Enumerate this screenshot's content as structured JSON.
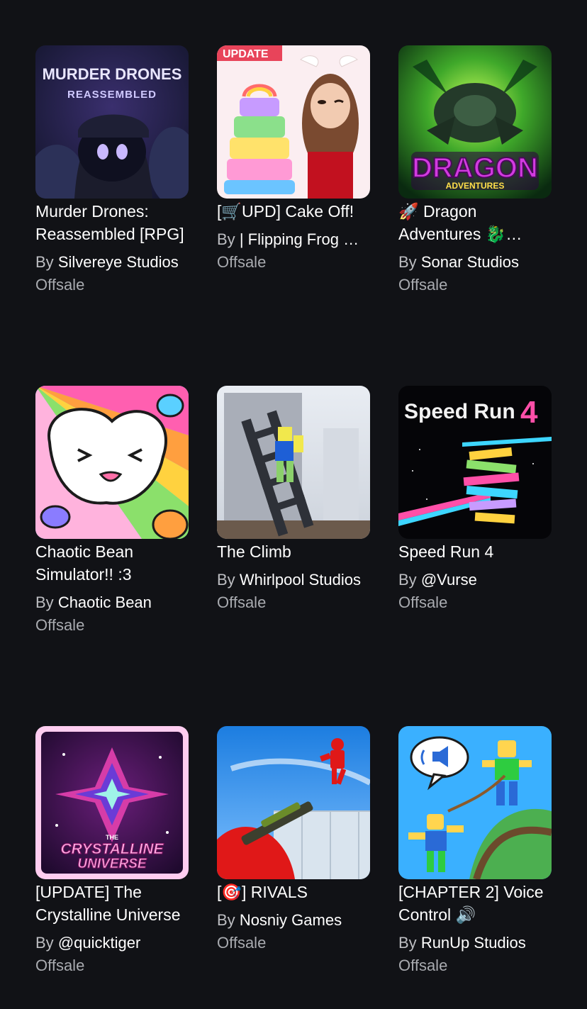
{
  "games": [
    {
      "title": "Murder Drones: Reassembled [RPG]",
      "by_label": "By",
      "creator": "Silvereye Studios",
      "price": "Offsale",
      "thumb_text": [
        "MURDER DRONES",
        "REASSEMBLED"
      ],
      "thumb_colors": [
        "#1b1e3a",
        "#3a2f6e",
        "#8a7cff"
      ],
      "icon": "murder-drones-thumbnail-icon"
    },
    {
      "title": "[🛒UPD] Cake Off!",
      "by_label": "By",
      "creator": "| Flipping Frog Games",
      "price": "Offsale",
      "thumb_text": [
        "UPDATE"
      ],
      "thumb_colors": [
        "#fdf2f4",
        "#e8445a",
        "#6bc4ff"
      ],
      "icon": "cake-off-thumbnail-icon"
    },
    {
      "title": "🚀 Dragon Adventures 🐉 [UPDATE]",
      "by_label": "By",
      "creator": "Sonar Studios",
      "price": "Offsale",
      "thumb_text": [
        "DRAGON",
        "ADVENTURES"
      ],
      "thumb_colors": [
        "#0b3d1a",
        "#6de03a",
        "#c32bd9"
      ],
      "icon": "dragon-adventures-thumbnail-icon"
    },
    {
      "title": "Chaotic Bean Simulator!! :3",
      "by_label": "By",
      "creator": "Chaotic Bean",
      "price": "Offsale",
      "thumb_text": [],
      "thumb_colors": [
        "#ff5fb0",
        "#ffd23f",
        "#5ad0ff"
      ],
      "icon": "chaotic-bean-thumbnail-icon"
    },
    {
      "title": "The Climb",
      "by_label": "By",
      "creator": "Whirlpool Studios",
      "price": "Offsale",
      "thumb_text": [],
      "thumb_colors": [
        "#dde2ea",
        "#3b3f47",
        "#f1e84c"
      ],
      "icon": "the-climb-thumbnail-icon"
    },
    {
      "title": "Speed Run 4",
      "by_label": "By",
      "creator": "@Vurse",
      "price": "Offsale",
      "thumb_text": [
        "Speed Run",
        "4"
      ],
      "thumb_colors": [
        "#050508",
        "#ff4fa8",
        "#3dd6ff"
      ],
      "icon": "speed-run-thumbnail-icon"
    },
    {
      "title": "[UPDATE] The Crystalline Universe",
      "by_label": "By",
      "creator": "@quicktiger",
      "price": "Offsale",
      "thumb_text": [
        "THE",
        "CRYSTALLINE",
        "UNIVERSE"
      ],
      "thumb_colors": [
        "#2a0b3e",
        "#d63ca8",
        "#ffcdf0"
      ],
      "icon": "crystalline-universe-thumbnail-icon"
    },
    {
      "title": "[🎯] RIVALS",
      "by_label": "By",
      "creator": "Nosniy Games",
      "price": "Offsale",
      "thumb_text": [],
      "thumb_colors": [
        "#1c7de0",
        "#e01818",
        "#d9e4ee"
      ],
      "icon": "rivals-thumbnail-icon"
    },
    {
      "title": "[CHAPTER 2] Voice Control 🔊",
      "by_label": "By",
      "creator": "RunUp Studios",
      "price": "Offsale",
      "thumb_text": [],
      "thumb_colors": [
        "#3ab0ff",
        "#4caf50",
        "#ffd54f"
      ],
      "icon": "voice-control-thumbnail-icon"
    }
  ]
}
